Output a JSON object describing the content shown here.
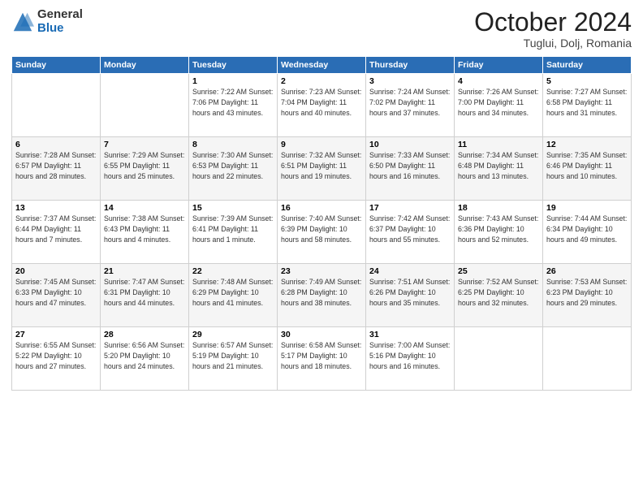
{
  "logo": {
    "general": "General",
    "blue": "Blue"
  },
  "title": "October 2024",
  "subtitle": "Tuglui, Dolj, Romania",
  "headers": [
    "Sunday",
    "Monday",
    "Tuesday",
    "Wednesday",
    "Thursday",
    "Friday",
    "Saturday"
  ],
  "weeks": [
    [
      {
        "num": "",
        "info": ""
      },
      {
        "num": "",
        "info": ""
      },
      {
        "num": "1",
        "info": "Sunrise: 7:22 AM\nSunset: 7:06 PM\nDaylight: 11 hours and 43 minutes."
      },
      {
        "num": "2",
        "info": "Sunrise: 7:23 AM\nSunset: 7:04 PM\nDaylight: 11 hours and 40 minutes."
      },
      {
        "num": "3",
        "info": "Sunrise: 7:24 AM\nSunset: 7:02 PM\nDaylight: 11 hours and 37 minutes."
      },
      {
        "num": "4",
        "info": "Sunrise: 7:26 AM\nSunset: 7:00 PM\nDaylight: 11 hours and 34 minutes."
      },
      {
        "num": "5",
        "info": "Sunrise: 7:27 AM\nSunset: 6:58 PM\nDaylight: 11 hours and 31 minutes."
      }
    ],
    [
      {
        "num": "6",
        "info": "Sunrise: 7:28 AM\nSunset: 6:57 PM\nDaylight: 11 hours and 28 minutes."
      },
      {
        "num": "7",
        "info": "Sunrise: 7:29 AM\nSunset: 6:55 PM\nDaylight: 11 hours and 25 minutes."
      },
      {
        "num": "8",
        "info": "Sunrise: 7:30 AM\nSunset: 6:53 PM\nDaylight: 11 hours and 22 minutes."
      },
      {
        "num": "9",
        "info": "Sunrise: 7:32 AM\nSunset: 6:51 PM\nDaylight: 11 hours and 19 minutes."
      },
      {
        "num": "10",
        "info": "Sunrise: 7:33 AM\nSunset: 6:50 PM\nDaylight: 11 hours and 16 minutes."
      },
      {
        "num": "11",
        "info": "Sunrise: 7:34 AM\nSunset: 6:48 PM\nDaylight: 11 hours and 13 minutes."
      },
      {
        "num": "12",
        "info": "Sunrise: 7:35 AM\nSunset: 6:46 PM\nDaylight: 11 hours and 10 minutes."
      }
    ],
    [
      {
        "num": "13",
        "info": "Sunrise: 7:37 AM\nSunset: 6:44 PM\nDaylight: 11 hours and 7 minutes."
      },
      {
        "num": "14",
        "info": "Sunrise: 7:38 AM\nSunset: 6:43 PM\nDaylight: 11 hours and 4 minutes."
      },
      {
        "num": "15",
        "info": "Sunrise: 7:39 AM\nSunset: 6:41 PM\nDaylight: 11 hours and 1 minute."
      },
      {
        "num": "16",
        "info": "Sunrise: 7:40 AM\nSunset: 6:39 PM\nDaylight: 10 hours and 58 minutes."
      },
      {
        "num": "17",
        "info": "Sunrise: 7:42 AM\nSunset: 6:37 PM\nDaylight: 10 hours and 55 minutes."
      },
      {
        "num": "18",
        "info": "Sunrise: 7:43 AM\nSunset: 6:36 PM\nDaylight: 10 hours and 52 minutes."
      },
      {
        "num": "19",
        "info": "Sunrise: 7:44 AM\nSunset: 6:34 PM\nDaylight: 10 hours and 49 minutes."
      }
    ],
    [
      {
        "num": "20",
        "info": "Sunrise: 7:45 AM\nSunset: 6:33 PM\nDaylight: 10 hours and 47 minutes."
      },
      {
        "num": "21",
        "info": "Sunrise: 7:47 AM\nSunset: 6:31 PM\nDaylight: 10 hours and 44 minutes."
      },
      {
        "num": "22",
        "info": "Sunrise: 7:48 AM\nSunset: 6:29 PM\nDaylight: 10 hours and 41 minutes."
      },
      {
        "num": "23",
        "info": "Sunrise: 7:49 AM\nSunset: 6:28 PM\nDaylight: 10 hours and 38 minutes."
      },
      {
        "num": "24",
        "info": "Sunrise: 7:51 AM\nSunset: 6:26 PM\nDaylight: 10 hours and 35 minutes."
      },
      {
        "num": "25",
        "info": "Sunrise: 7:52 AM\nSunset: 6:25 PM\nDaylight: 10 hours and 32 minutes."
      },
      {
        "num": "26",
        "info": "Sunrise: 7:53 AM\nSunset: 6:23 PM\nDaylight: 10 hours and 29 minutes."
      }
    ],
    [
      {
        "num": "27",
        "info": "Sunrise: 6:55 AM\nSunset: 5:22 PM\nDaylight: 10 hours and 27 minutes."
      },
      {
        "num": "28",
        "info": "Sunrise: 6:56 AM\nSunset: 5:20 PM\nDaylight: 10 hours and 24 minutes."
      },
      {
        "num": "29",
        "info": "Sunrise: 6:57 AM\nSunset: 5:19 PM\nDaylight: 10 hours and 21 minutes."
      },
      {
        "num": "30",
        "info": "Sunrise: 6:58 AM\nSunset: 5:17 PM\nDaylight: 10 hours and 18 minutes."
      },
      {
        "num": "31",
        "info": "Sunrise: 7:00 AM\nSunset: 5:16 PM\nDaylight: 10 hours and 16 minutes."
      },
      {
        "num": "",
        "info": ""
      },
      {
        "num": "",
        "info": ""
      }
    ]
  ]
}
